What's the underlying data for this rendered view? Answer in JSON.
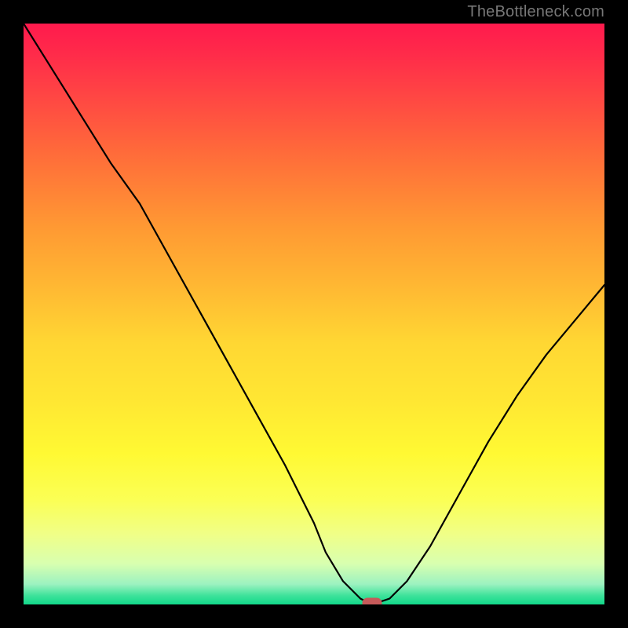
{
  "watermark": "TheBottleneck.com",
  "chart_data": {
    "type": "line",
    "title": "",
    "xlabel": "",
    "ylabel": "",
    "xlim": [
      0,
      100
    ],
    "ylim": [
      0,
      100
    ],
    "grid": false,
    "legend": false,
    "background_gradient": {
      "top_color": "#ff1a4d",
      "mid_color": "#ffe733",
      "bottom_color": "#12d88a"
    },
    "series": [
      {
        "name": "bottleneck-curve",
        "color": "#000000",
        "x": [
          0,
          5,
          10,
          15,
          20,
          25,
          30,
          35,
          40,
          45,
          50,
          52,
          55,
          58,
          60,
          63,
          66,
          70,
          75,
          80,
          85,
          90,
          95,
          100
        ],
        "y": [
          100,
          92,
          84,
          76,
          69,
          60,
          51,
          42,
          33,
          24,
          14,
          9,
          4,
          1,
          0,
          1,
          4,
          10,
          19,
          28,
          36,
          43,
          49,
          55
        ]
      }
    ],
    "marker": {
      "name": "optimal-point",
      "x": 60,
      "y": 0,
      "color": "#c65a5a",
      "shape": "rounded-rect"
    }
  }
}
